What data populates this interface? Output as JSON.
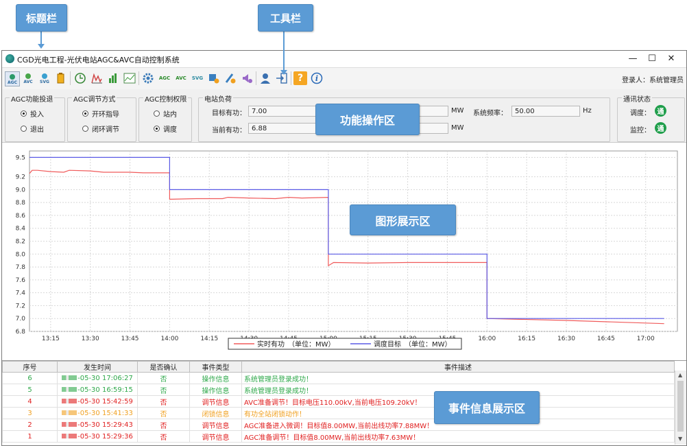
{
  "window": {
    "title": "CGD光电工程-光伏电站AGC&AVC自动控制系统"
  },
  "toolbar": {
    "icons": [
      "agc-icon",
      "avc-icon",
      "svg-icon",
      "battery-icon",
      "clock-icon",
      "curve-icon",
      "bar-chart-icon",
      "line-chart-icon",
      "settings-icon",
      "agc-settings-icon",
      "avc-settings-icon",
      "svg-settings-icon",
      "paint-settings-icon",
      "brush-settings-icon",
      "sound-settings-icon",
      "user-icon",
      "logout-icon",
      "help-icon",
      "info-icon"
    ],
    "agc": "AGC",
    "avc": "AVC",
    "svg": "SVG",
    "login_label": "登录人：",
    "login_user": "系统管理员"
  },
  "callouts": {
    "titlebar": "标题栏",
    "toolbar": "工具栏",
    "function": "功能操作区",
    "chart": "图形展示区",
    "events": "事件信息展示区"
  },
  "panel": {
    "agc_switch": {
      "title": "AGC功能投退",
      "options": [
        "投入",
        "退出"
      ],
      "selected": "投入"
    },
    "agc_mode": {
      "title": "AGC调节方式",
      "options": [
        "开环指导",
        "闭环调节"
      ],
      "selected": "开环指导"
    },
    "agc_authority": {
      "title": "AGC控制权限",
      "options": [
        "站内",
        "调度"
      ],
      "selected": "调度"
    },
    "load": {
      "title": "电站负荷",
      "target_label": "目标有功：",
      "target_value": "7.00",
      "target_unit": "MW",
      "current_label": "当前有功：",
      "current_value": "6.88",
      "current_unit": "MW",
      "freq_label": "系统频率：",
      "freq_value": "50.00",
      "freq_unit": "Hz"
    },
    "comm": {
      "title": "通讯状态",
      "dispatch_label": "调度：",
      "dispatch_status": "通",
      "monitor_label": "监控：",
      "monitor_status": "通"
    }
  },
  "chart_data": {
    "type": "line",
    "ylim": [
      6.8,
      9.6
    ],
    "yticks": [
      "6.8",
      "7.0",
      "7.2",
      "7.4",
      "7.6",
      "7.8",
      "8.0",
      "8.2",
      "8.4",
      "8.6",
      "8.8",
      "9.0",
      "9.2",
      "9.5"
    ],
    "xticks": [
      "13:15",
      "13:30",
      "13:45",
      "14:00",
      "14:15",
      "14:30",
      "14:45",
      "15:00",
      "15:15",
      "15:30",
      "15:45",
      "16:00",
      "16:15",
      "16:30",
      "16:45",
      "17:00"
    ],
    "grid": true,
    "legend_position": "bottom-center",
    "series": [
      {
        "name": "实时有功　（单位：MW）",
        "color": "#f05a5a",
        "points": [
          [
            "13:07",
            9.25
          ],
          [
            "13:08",
            9.3
          ],
          [
            "13:10",
            9.3
          ],
          [
            "13:15",
            9.28
          ],
          [
            "13:20",
            9.27
          ],
          [
            "13:22",
            9.3
          ],
          [
            "13:30",
            9.29
          ],
          [
            "13:35",
            9.27
          ],
          [
            "13:45",
            9.27
          ],
          [
            "13:50",
            9.26
          ],
          [
            "14:00",
            9.26
          ],
          [
            "14:00",
            8.85
          ],
          [
            "14:10",
            8.86
          ],
          [
            "14:20",
            8.86
          ],
          [
            "14:22",
            8.88
          ],
          [
            "14:30",
            8.87
          ],
          [
            "14:40",
            8.86
          ],
          [
            "14:45",
            8.88
          ],
          [
            "14:50",
            8.87
          ],
          [
            "15:00",
            8.88
          ],
          [
            "15:00",
            7.82
          ],
          [
            "15:02",
            7.87
          ],
          [
            "15:15",
            7.86
          ],
          [
            "15:30",
            7.87
          ],
          [
            "15:45",
            7.87
          ],
          [
            "16:00",
            7.87
          ],
          [
            "16:00",
            7.0
          ],
          [
            "16:30",
            6.97
          ],
          [
            "17:07",
            6.92
          ]
        ]
      },
      {
        "name": "调度目标　（单位：MW）",
        "color": "#5a5ae6",
        "points": [
          [
            "13:07",
            9.5
          ],
          [
            "14:00",
            9.5
          ],
          [
            "14:00",
            9.0
          ],
          [
            "15:00",
            9.0
          ],
          [
            "15:00",
            8.0
          ],
          [
            "16:00",
            8.0
          ],
          [
            "16:00",
            7.0
          ],
          [
            "17:07",
            7.0
          ]
        ]
      }
    ]
  },
  "events": {
    "headers": [
      "序号",
      "发生时间",
      "是否确认",
      "事件类型",
      "事件描述"
    ],
    "rows": [
      {
        "no": "6",
        "time": "-05-30 17:06:27",
        "confirmed": "否",
        "type": "操作信息",
        "desc": "系统管理员登录成功！",
        "color": "#2ea84a"
      },
      {
        "no": "5",
        "time": "-05-30 16:59:15",
        "confirmed": "否",
        "type": "操作信息",
        "desc": "系统管理员登录成功！",
        "color": "#2ea84a"
      },
      {
        "no": "4",
        "time": "-05-30 15:42:59",
        "confirmed": "否",
        "type": "调节信息",
        "desc": "AVC准备调节！目标电压110.00kV,当前电压109.20kV！",
        "color": "#e02020"
      },
      {
        "no": "3",
        "time": "-05-30 15:41:33",
        "confirmed": "否",
        "type": "闭锁信息",
        "desc": "有功全站闭锁动作！",
        "color": "#f0a020"
      },
      {
        "no": "2",
        "time": "-05-30 15:29:43",
        "confirmed": "否",
        "type": "调节信息",
        "desc": "AGC准备进入微调！目标值8.00MW,当前出线功率7.88MW！",
        "color": "#e02020"
      },
      {
        "no": "1",
        "time": "-05-30 15:29:36",
        "confirmed": "否",
        "type": "调节信息",
        "desc": "AGC准备调节！目标值8.00MW,当前出线功率7.63MW！",
        "color": "#e02020"
      }
    ]
  }
}
